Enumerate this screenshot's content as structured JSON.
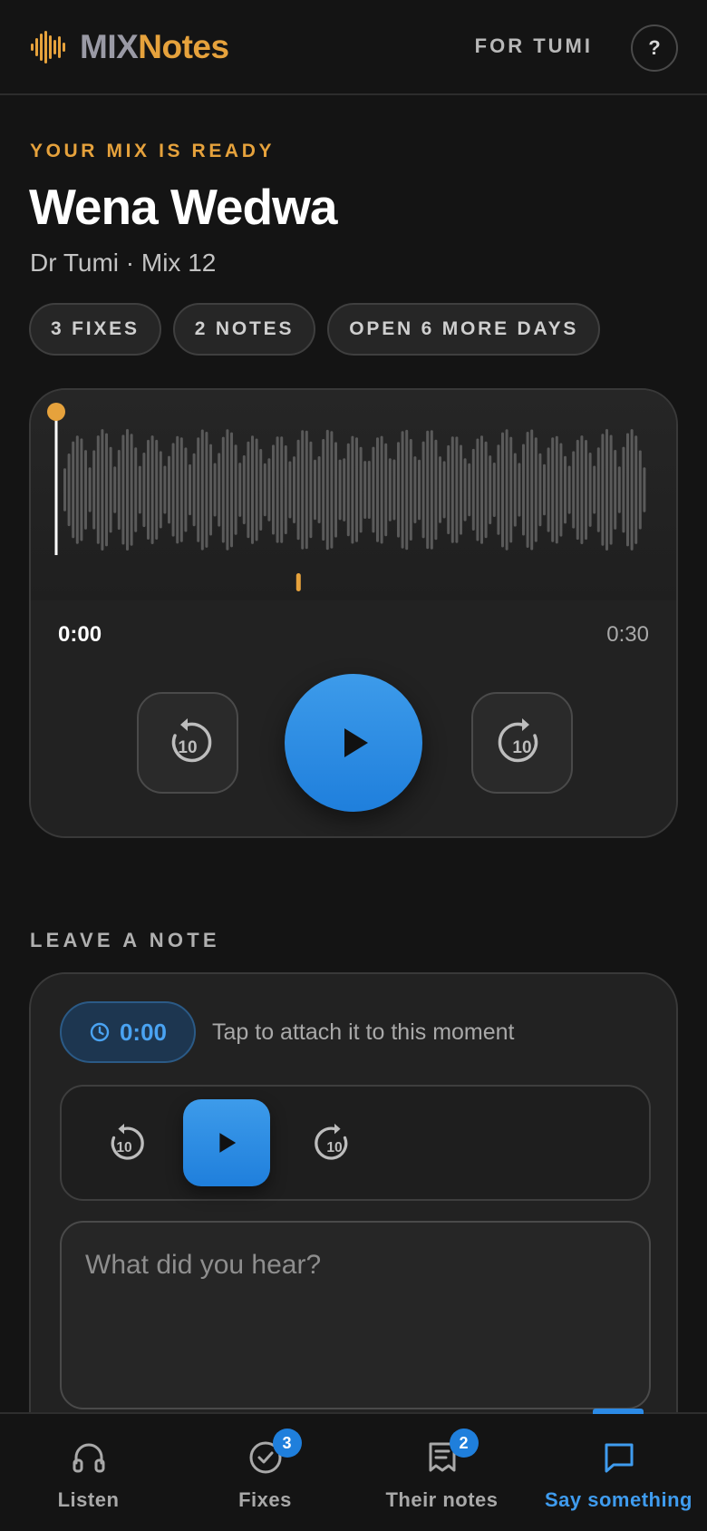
{
  "header": {
    "logo_mix": "MIX",
    "logo_notes": "Notes",
    "for_label": "FOR TUMI",
    "help_label": "?"
  },
  "mix": {
    "eyebrow": "YOUR MIX IS READY",
    "title": "Wena Wedwa",
    "subtitle": "Dr Tumi · Mix 12",
    "chips": [
      "3 FIXES",
      "2 NOTES",
      "OPEN 6 MORE DAYS"
    ]
  },
  "player": {
    "current_time": "0:00",
    "total_time": "0:30",
    "skip_back_label": "10",
    "skip_forward_label": "10",
    "progress_fraction": 0.0,
    "note_marker_fraction": 0.405
  },
  "note": {
    "section_label": "LEAVE A NOTE",
    "timestamp": "0:00",
    "attach_hint": "Tap to attach it to this moment",
    "mini_skip_label": "10",
    "input_placeholder": "What did you hear?"
  },
  "nav": {
    "items": [
      {
        "label": "Listen",
        "icon": "headphones-icon",
        "badge": null
      },
      {
        "label": "Fixes",
        "icon": "check-circle-icon",
        "badge": "3"
      },
      {
        "label": "Their notes",
        "icon": "notes-icon",
        "badge": "2"
      },
      {
        "label": "Say something",
        "icon": "chat-bubble-icon",
        "badge": null
      }
    ],
    "active_index": 3
  },
  "colors": {
    "accent_gold": "#e6a23c",
    "accent_blue": "#2b8ae6",
    "background": "#141414",
    "card": "#222222"
  }
}
